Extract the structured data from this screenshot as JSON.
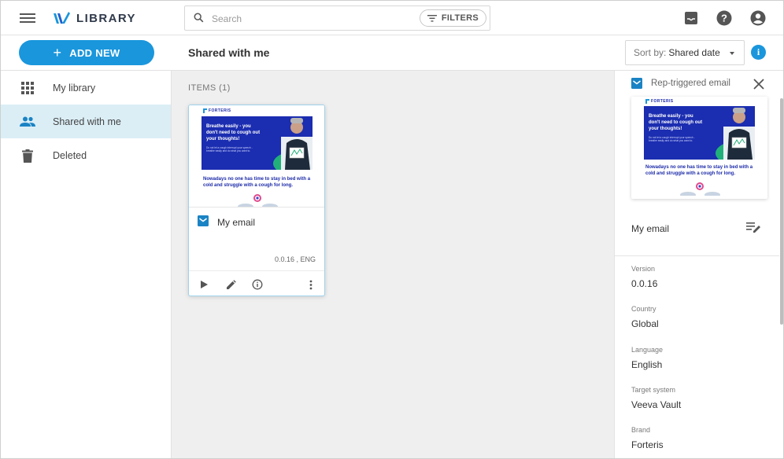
{
  "app": {
    "name": "LIBRARY"
  },
  "header": {
    "search_placeholder": "Search",
    "filters_label": "FILTERS"
  },
  "toolbar": {
    "add_new_label": "ADD NEW",
    "page_title": "Shared with me",
    "sort_prefix": "Sort by:",
    "sort_value": "Shared date"
  },
  "sidebar": {
    "items": [
      {
        "label": "My library",
        "icon": "grid-icon",
        "active": false
      },
      {
        "label": "Shared with me",
        "icon": "people-icon",
        "active": true
      },
      {
        "label": "Deleted",
        "icon": "trash-icon",
        "active": false
      }
    ]
  },
  "main": {
    "items_count": "ITEMS (1)",
    "card": {
      "name": "My email",
      "meta": "0.0.16 , ENG"
    }
  },
  "email_preview": {
    "brand": "FORTERIS",
    "headline": "Breathe easily - you don't need to cough out your thoughts!",
    "subline": "Do not let a cough interrupt your speech - breathe easily and do what you want to.",
    "body": "Nowadays no one has time to stay in bed with a cold and struggle with a cough for long."
  },
  "panel": {
    "title": "Rep-triggered email",
    "name": "My email",
    "properties": [
      {
        "label": "Version",
        "value": "0.0.16"
      },
      {
        "label": "Country",
        "value": "Global"
      },
      {
        "label": "Language",
        "value": "English"
      },
      {
        "label": "Target system",
        "value": "Veeva Vault"
      },
      {
        "label": "Brand",
        "value": "Forteris"
      }
    ]
  },
  "colors": {
    "accent": "#1a96dc",
    "active_nav": "#dbeef6",
    "email_blue": "#1b2db0",
    "email_green": "#21b07a"
  }
}
